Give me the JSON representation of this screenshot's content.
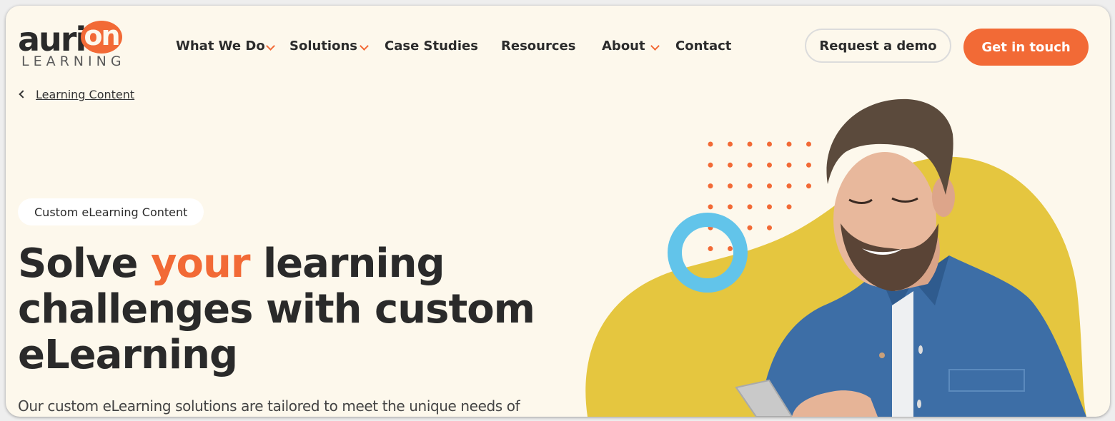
{
  "brand": {
    "logo_main": "auri",
    "logo_accent": "on",
    "logo_sub": "LEARNING",
    "colors": {
      "accent": "#f26a36",
      "background": "#fdf8ec",
      "text": "#2a2a2a",
      "yellow": "#e5c63f",
      "blue": "#62c4ea"
    }
  },
  "nav": {
    "items": [
      {
        "label": "What We Do",
        "has_dropdown": true
      },
      {
        "label": "Solutions",
        "has_dropdown": true
      },
      {
        "label": "Case Studies",
        "has_dropdown": false
      },
      {
        "label": "Resources",
        "has_dropdown": false
      },
      {
        "label": "About",
        "has_dropdown": true
      },
      {
        "label": "Contact",
        "has_dropdown": false
      }
    ],
    "request_demo_label": "Request a demo",
    "get_in_touch_label": "Get in touch"
  },
  "breadcrumb": {
    "back_icon": "chevron-left-icon",
    "label": "Learning Content"
  },
  "hero": {
    "tag": "Custom eLearning Content",
    "headline_pre": "Solve ",
    "headline_accent": "your",
    "headline_post": " learning challenges with custom eLearning",
    "lead": "Our custom eLearning solutions are tailored to meet the unique needs of",
    "image_alt": "Smiling man in denim shirt using a smartphone"
  }
}
